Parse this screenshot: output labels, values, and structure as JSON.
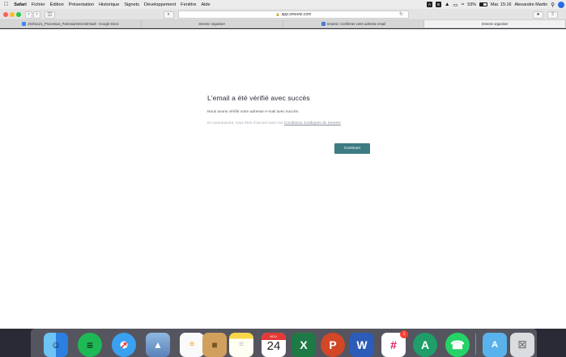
{
  "menubar": {
    "apple": "",
    "app_name": "Safari",
    "items": [
      "Fichier",
      "Édition",
      "Présentation",
      "Historique",
      "Signets",
      "Développement",
      "Fenêtre",
      "Aide"
    ],
    "battery": "53%",
    "clock": "Mar. 15:16",
    "user": "Alexandre Martin"
  },
  "toolbar": {
    "address": "app.smeetz.com"
  },
  "tabs": [
    {
      "label": "20201121_Processus_PartenairesGestriVault - Google Docs",
      "favicon_color": "#4285f4"
    },
    {
      "label": "Smeetz organiser",
      "favicon_color": ""
    },
    {
      "label": "Smeetz: Confirmer votre adresse email",
      "favicon_color": "#4a7bd0"
    },
    {
      "label": "Smeetz organiser",
      "favicon_color": ""
    }
  ],
  "content": {
    "title": "L'email a été vérifié avec succès",
    "message": "Nous avons vérifié votre adresse e-mail avec succès.",
    "terms_prefix": "En poursuivant, vous êtes d'accord avec les ",
    "terms_link": "Conditions Juridiques de Smeetz",
    "continue_label": "Continuer"
  },
  "dock": {
    "calendar_month": "NOV.",
    "calendar_day": "24",
    "slack_badge": "1"
  },
  "colors": {
    "accent": "#3c7c82",
    "menubar": "#ececec"
  }
}
